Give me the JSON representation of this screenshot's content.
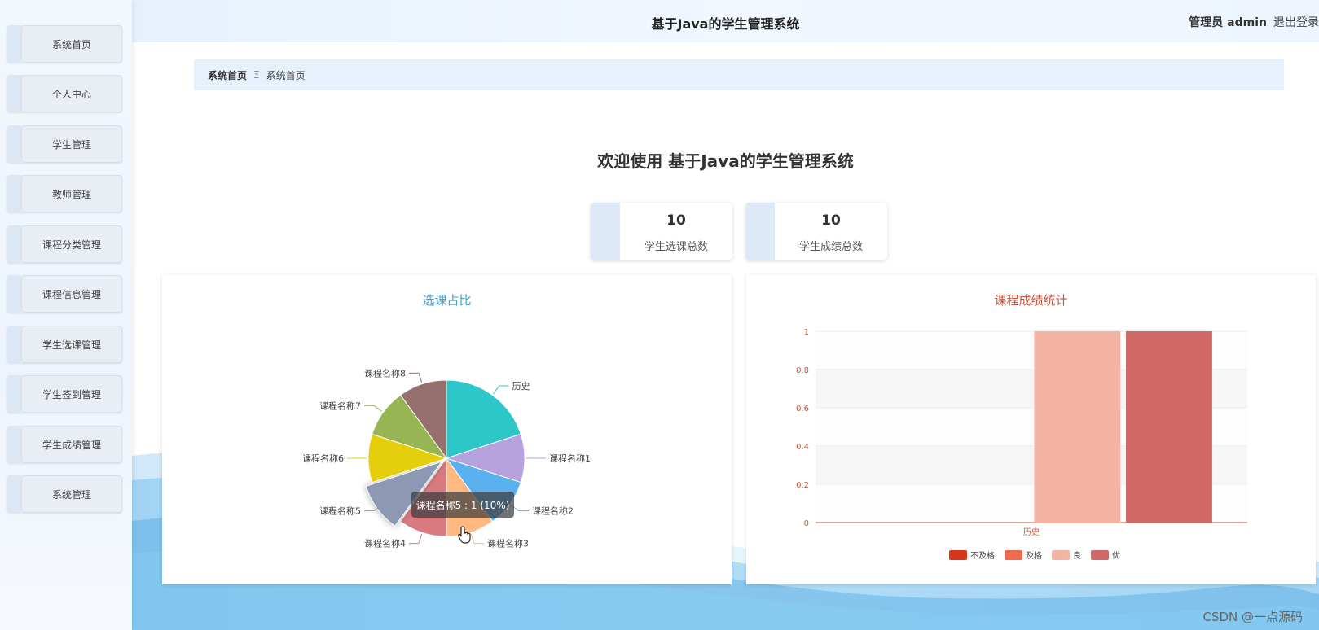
{
  "header": {
    "title": "基于Java的学生管理系统",
    "user": "管理员 admin",
    "logout": "退出登录"
  },
  "sidebar": {
    "items": [
      {
        "label": "系统首页"
      },
      {
        "label": "个人中心"
      },
      {
        "label": "学生管理"
      },
      {
        "label": "教师管理"
      },
      {
        "label": "课程分类管理"
      },
      {
        "label": "课程信息管理"
      },
      {
        "label": "学生选课管理"
      },
      {
        "label": "学生签到管理"
      },
      {
        "label": "学生成绩管理"
      },
      {
        "label": "系统管理"
      }
    ]
  },
  "breadcrumb": {
    "home": "系统首页",
    "separator": "Ξ",
    "current": "系统首页"
  },
  "welcome": "欢迎使用 基于Java的学生管理系统",
  "stats": [
    {
      "value": "10",
      "label": "学生选课总数"
    },
    {
      "value": "10",
      "label": "学生成绩总数"
    }
  ],
  "pie_panel": {
    "title": "选课占比",
    "title_color": "#3c9ec4",
    "tooltip": "课程名称5 : 1 (10%)"
  },
  "bar_panel": {
    "title": "课程成绩统计",
    "title_color": "#c8553d"
  },
  "watermark": "CSDN @一点源码",
  "chart_data": [
    {
      "type": "pie",
      "title": "选课占比",
      "slices": [
        {
          "label": "历史",
          "value": 2,
          "color": "#2ec7c9"
        },
        {
          "label": "课程名称1",
          "value": 1,
          "color": "#b6a2de"
        },
        {
          "label": "课程名称2",
          "value": 1,
          "color": "#5ab1ef"
        },
        {
          "label": "课程名称3",
          "value": 1,
          "color": "#ffb980"
        },
        {
          "label": "课程名称4",
          "value": 1,
          "color": "#d87a80"
        },
        {
          "label": "课程名称5",
          "value": 1,
          "color": "#8d98b3"
        },
        {
          "label": "课程名称6",
          "value": 1,
          "color": "#e5cf0d"
        },
        {
          "label": "课程名称7",
          "value": 1,
          "color": "#97b552"
        },
        {
          "label": "课程名称8",
          "value": 1,
          "color": "#95706d"
        }
      ],
      "highlighted": "课程名称5"
    },
    {
      "type": "bar",
      "title": "课程成绩统计",
      "categories": [
        "历史"
      ],
      "series": [
        {
          "name": "不及格",
          "values": [
            0
          ],
          "color": "#d7361c"
        },
        {
          "name": "及格",
          "values": [
            0
          ],
          "color": "#ef6b4d"
        },
        {
          "name": "良",
          "values": [
            1
          ],
          "color": "#f3b4a4"
        },
        {
          "name": "优",
          "values": [
            1
          ],
          "color": "#d06868"
        }
      ],
      "yticks": [
        "0",
        "0.2",
        "0.4",
        "0.6",
        "0.8",
        "1"
      ],
      "ylim": [
        0,
        1
      ],
      "legend": "bottom"
    }
  ]
}
